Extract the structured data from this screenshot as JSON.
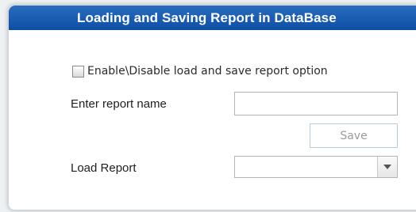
{
  "panel": {
    "title": "Loading and Saving Report in DataBase"
  },
  "options": {
    "enable_label": "Enable\\Disable load and save report option",
    "enable_checked": false
  },
  "report_name": {
    "label": "Enter report name",
    "value": "",
    "placeholder": ""
  },
  "save_button": {
    "label": "Save"
  },
  "load_report": {
    "label": "Load Report",
    "selected": ""
  }
}
